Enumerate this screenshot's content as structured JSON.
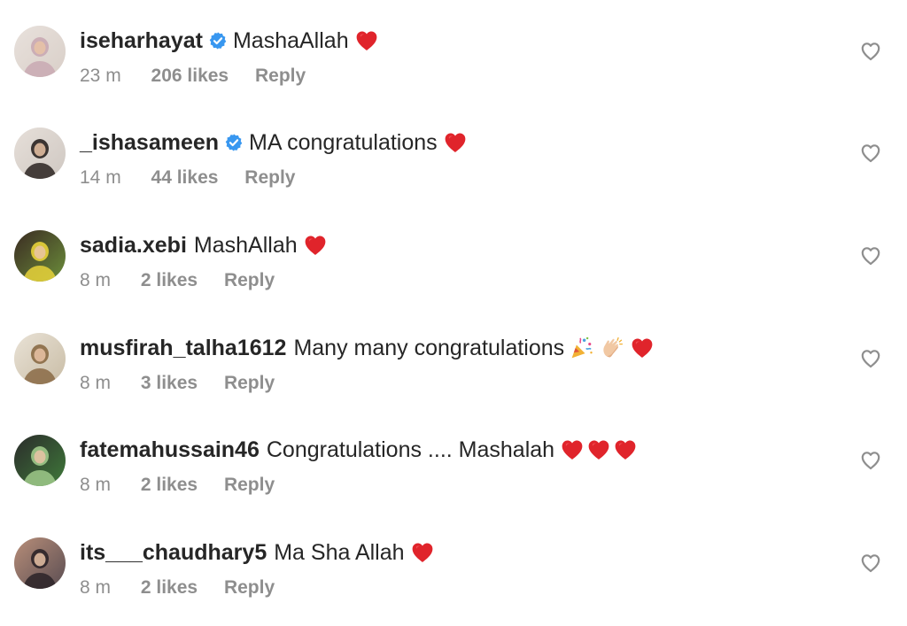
{
  "comments": [
    {
      "username": "iseharhayat",
      "verified": true,
      "text": "MashaAllah",
      "emojis": [
        "red-heart"
      ],
      "time": "23 m",
      "likes": "206 likes",
      "reply": "Reply",
      "avatar_colors": [
        "#d9cfc8",
        "#c9a9b3",
        "#e8e1dc"
      ]
    },
    {
      "username": "_ishasameen",
      "verified": true,
      "text": "MA congratulations",
      "emojis": [
        "red-heart"
      ],
      "time": "14 m",
      "likes": "44 likes",
      "reply": "Reply",
      "avatar_colors": [
        "#cfc8c2",
        "#2a2321",
        "#e6dfd9"
      ]
    },
    {
      "username": "sadia.xebi",
      "verified": false,
      "text": "MashAllah",
      "emojis": [
        "red-heart"
      ],
      "time": "8 m",
      "likes": "2 likes",
      "reply": "Reply",
      "avatar_colors": [
        "#6c8f3b",
        "#e8d23a",
        "#3a2a22"
      ]
    },
    {
      "username": "musfirah_talha1612",
      "verified": false,
      "text": "Many many congratulations",
      "emojis": [
        "party-popper",
        "clapping-hands",
        "red-heart"
      ],
      "time": "8 m",
      "likes": "3 likes",
      "reply": "Reply",
      "avatar_colors": [
        "#c9bda6",
        "#8a6a45",
        "#e9e2d6"
      ]
    },
    {
      "username": "fatemahussain46",
      "verified": false,
      "text": "Congratulations .... Mashalah",
      "emojis": [
        "red-heart",
        "red-heart",
        "red-heart"
      ],
      "time": "8 m",
      "likes": "2 likes",
      "reply": "Reply",
      "avatar_colors": [
        "#3f7a3a",
        "#9fc98a",
        "#2b2b2b"
      ]
    },
    {
      "username": "its___chaudhary5",
      "verified": false,
      "text": "Ma Sha Allah",
      "emojis": [
        "red-heart"
      ],
      "time": "8 m",
      "likes": "2 likes",
      "reply": "Reply",
      "avatar_colors": [
        "#5a4d52",
        "#2b2328",
        "#b88e79"
      ]
    }
  ],
  "colors": {
    "username": "#262626",
    "meta": "#8e8e8e",
    "verified_badge": "#3897f0",
    "heart_emoji": "#e0242b",
    "like_icon_stroke": "#8e8e8e"
  }
}
